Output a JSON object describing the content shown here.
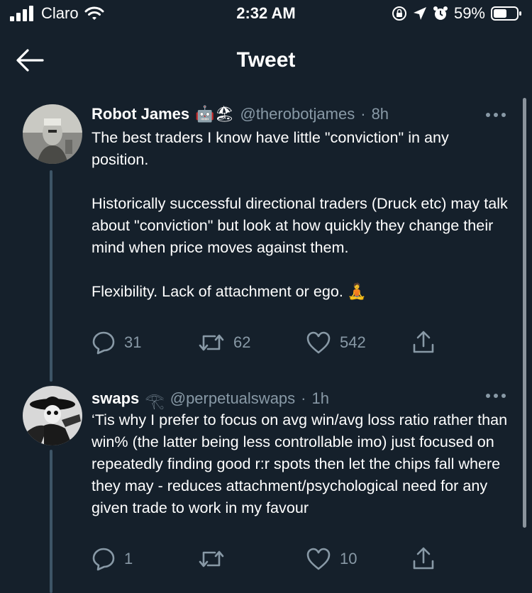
{
  "status_bar": {
    "carrier": "Claro",
    "time": "2:32 AM",
    "battery": "59%"
  },
  "header": {
    "title": "Tweet"
  },
  "tweets": [
    {
      "name": "Robot James",
      "name_emoji": "🤖🏖",
      "handle": "@therobotjames",
      "separator": "·",
      "time": "8h",
      "paragraphs": [
        "The best traders I know have little \"conviction\" in any position.",
        "Historically successful directional traders (Druck etc) may talk about \"conviction\" but look at how quickly they change their mind when price moves against them.",
        "Flexibility. Lack of attachment or ego. 🧘"
      ],
      "replies": "31",
      "retweets": "62",
      "likes": "542"
    },
    {
      "name": "swaps",
      "name_emoji": "𓂀",
      "handle": "@perpetualswaps",
      "separator": "·",
      "time": "1h",
      "paragraphs": [
        "‘Tis why I prefer to focus on avg win/avg loss ratio rather than win% (the latter being less controllable imo) just focused on repeatedly finding good r:r spots then let the chips fall where they may - reduces attachment/psychological need for any given trade to work in my favour"
      ],
      "replies": "1",
      "retweets": "",
      "likes": "10"
    }
  ],
  "icons": {
    "back": "arrow-left-icon",
    "more": "more-horizontal-icon",
    "reply": "reply-icon",
    "retweet": "retweet-icon",
    "like": "heart-icon",
    "share": "share-icon"
  },
  "colors": {
    "background": "#15202b",
    "secondary_text": "#8899a6",
    "thread_line": "#3d5466"
  }
}
